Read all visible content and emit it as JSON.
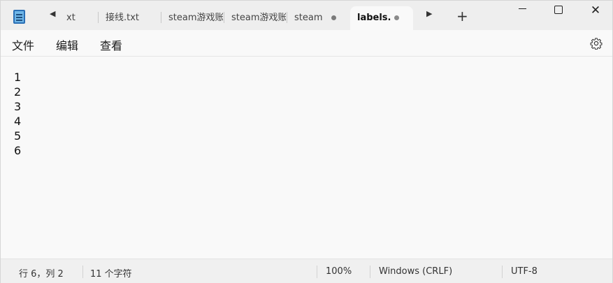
{
  "tabs": [
    {
      "label": "xt"
    },
    {
      "label": "接线.txt"
    },
    {
      "label": "steam游戏账"
    },
    {
      "label": "steam游戏账"
    },
    {
      "label": "steam"
    },
    {
      "label": "labels."
    }
  ],
  "new_tab_label": "+",
  "window_controls": {
    "close": "✕"
  },
  "menu": {
    "file": "文件",
    "edit": "编辑",
    "view": "查看"
  },
  "editor": {
    "lines": [
      "1",
      "2",
      "3",
      "4",
      "5",
      "6"
    ]
  },
  "status": {
    "position": "行 6，列 2",
    "char_count": "11 个字符",
    "zoom": "100%",
    "line_ending": "Windows (CRLF)",
    "encoding": "UTF-8"
  },
  "icons": {
    "app": "notepad-icon",
    "settings": "gear-icon",
    "scroll_left": "triangle-left-icon",
    "scroll_right": "triangle-right-icon"
  }
}
